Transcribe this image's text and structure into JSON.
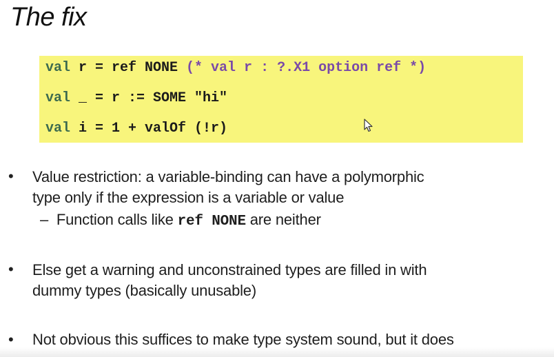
{
  "slide": {
    "title": "The fix"
  },
  "code": {
    "line1": {
      "kw": "val",
      "rest": " r = ref NONE ",
      "comment": "(* val r : ?.X1 option ref *)"
    },
    "line2": {
      "kw": "val",
      "rest": " _ = r := SOME \"hi\""
    },
    "line3": {
      "kw": "val",
      "rest": " i = 1 + valOf (!r)"
    }
  },
  "bullets": {
    "b1_line1": "Value restriction: a variable-binding can have a polymorphic",
    "b1_line2": "type only if the expression is a variable or value",
    "sub_dash": "–",
    "sub_pre": "Function calls like ",
    "sub_code": "ref NONE",
    "sub_post": " are neither",
    "b2_line1": "Else get a warning and unconstrained types are filled in with",
    "b2_line2": "dummy types (basically unusable)",
    "b3_line1": "Not obvious this suffices to make type system sound, but it does"
  },
  "colors": {
    "code_background": "#f8f57c",
    "keyword": "#3d6b4f",
    "comment": "#7a4aa8"
  },
  "icons": {
    "cursor": "mouse-pointer-icon",
    "bullet": "bullet-dot"
  }
}
